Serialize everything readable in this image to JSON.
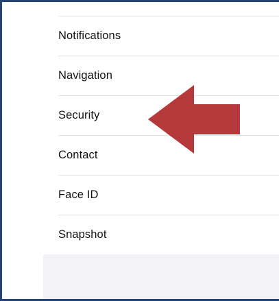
{
  "settings_list": {
    "items": [
      {
        "label": "Notifications"
      },
      {
        "label": "Navigation"
      },
      {
        "label": "Security"
      },
      {
        "label": "Contact"
      },
      {
        "label": "Face ID"
      },
      {
        "label": "Snapshot"
      }
    ]
  },
  "annotation": {
    "arrow_color": "#b5393b",
    "pointing_to": "Security"
  },
  "colors": {
    "frame_border": "#22446e",
    "separator": "#e3e3e6",
    "grouped_background": "#f2f2f7"
  }
}
